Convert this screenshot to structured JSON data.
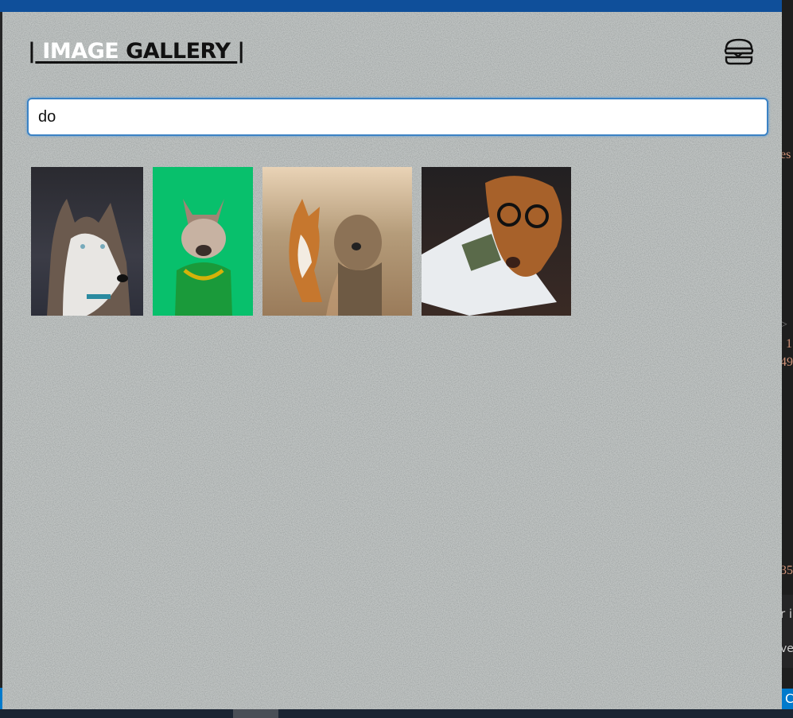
{
  "header": {
    "title_left_bar": "|",
    "title_word1": " IMAGE",
    "title_word2": " GALLERY ",
    "title_right_bar": "|",
    "menu_icon": "hamburger-icon"
  },
  "search": {
    "value": "do"
  },
  "gallery": {
    "images": [
      {
        "subject": "husky"
      },
      {
        "subject": "french-bulldog"
      },
      {
        "subject": "corgi-and-terrier"
      },
      {
        "subject": "dog-with-glasses"
      }
    ]
  },
  "background_editor": {
    "fragments": [
      "es",
      ">",
      "1",
      "49",
      "35",
      "r i",
      "ve",
      "C"
    ]
  },
  "colors": {
    "topbar": "#0f4f9a",
    "input_border": "#3b82c4",
    "editor_text": "#ce9178"
  }
}
